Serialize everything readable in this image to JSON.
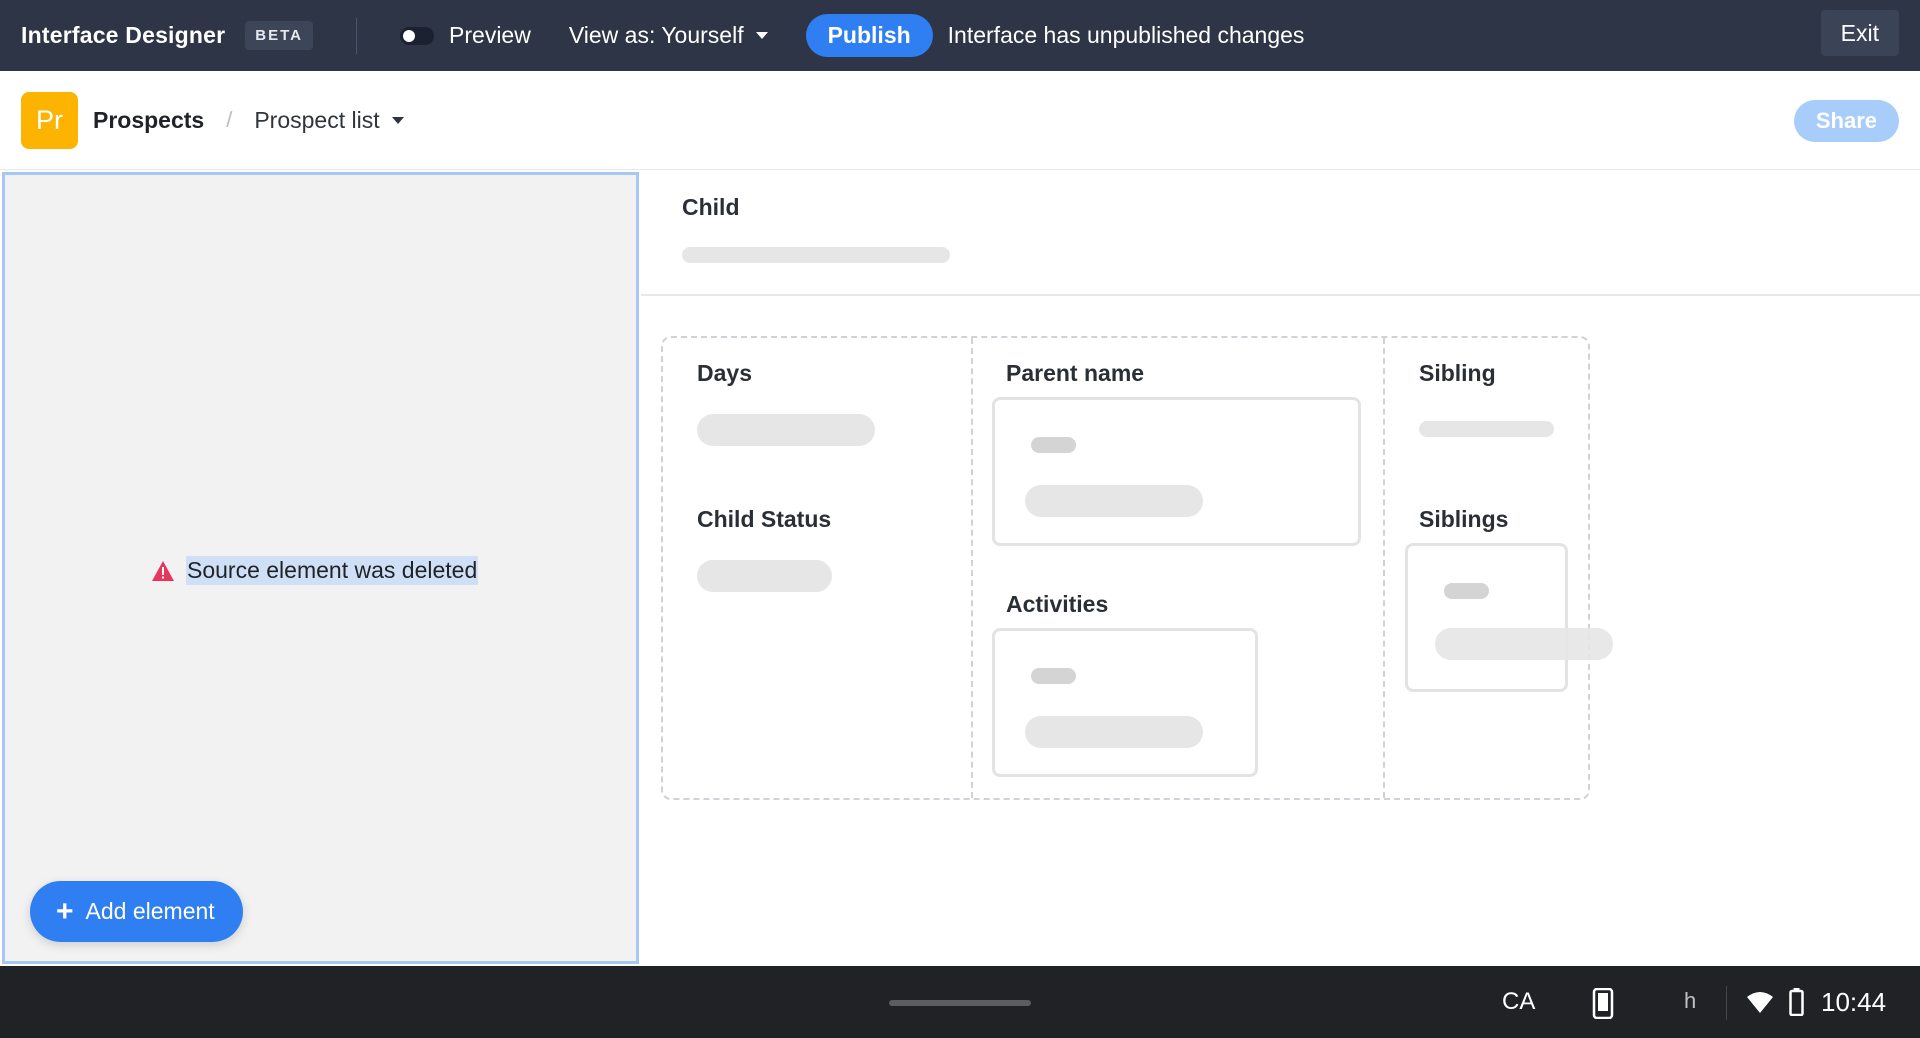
{
  "topbar": {
    "title": "Interface Designer",
    "badge": "BETA",
    "preview_label": "Preview",
    "view_as_label": "View as: Yourself",
    "publish_label": "Publish",
    "status_text": "Interface has unpublished changes",
    "exit_label": "Exit"
  },
  "header": {
    "app_icon_text": "Pr",
    "app_icon_color": "#fcb400",
    "breadcrumb_main": "Prospects",
    "breadcrumb_separator": "/",
    "breadcrumb_sub": "Prospect list",
    "share_label": "Share"
  },
  "left_panel": {
    "message": "Source element was deleted",
    "add_button_label": "Add element",
    "warning_color": "#e8355a"
  },
  "canvas": {
    "child_label": "Child",
    "fields": {
      "days": "Days",
      "child_status": "Child Status",
      "parent_name": "Parent name",
      "activities": "Activities",
      "sibling": "Sibling",
      "siblings": "Siblings"
    }
  },
  "system_bar": {
    "ca_label": "CA",
    "h_label": "h",
    "time": "10:44"
  },
  "colors": {
    "accent": "#2f7ff2",
    "topbar": "#2d3546",
    "selection_border": "#a6c8f2"
  }
}
